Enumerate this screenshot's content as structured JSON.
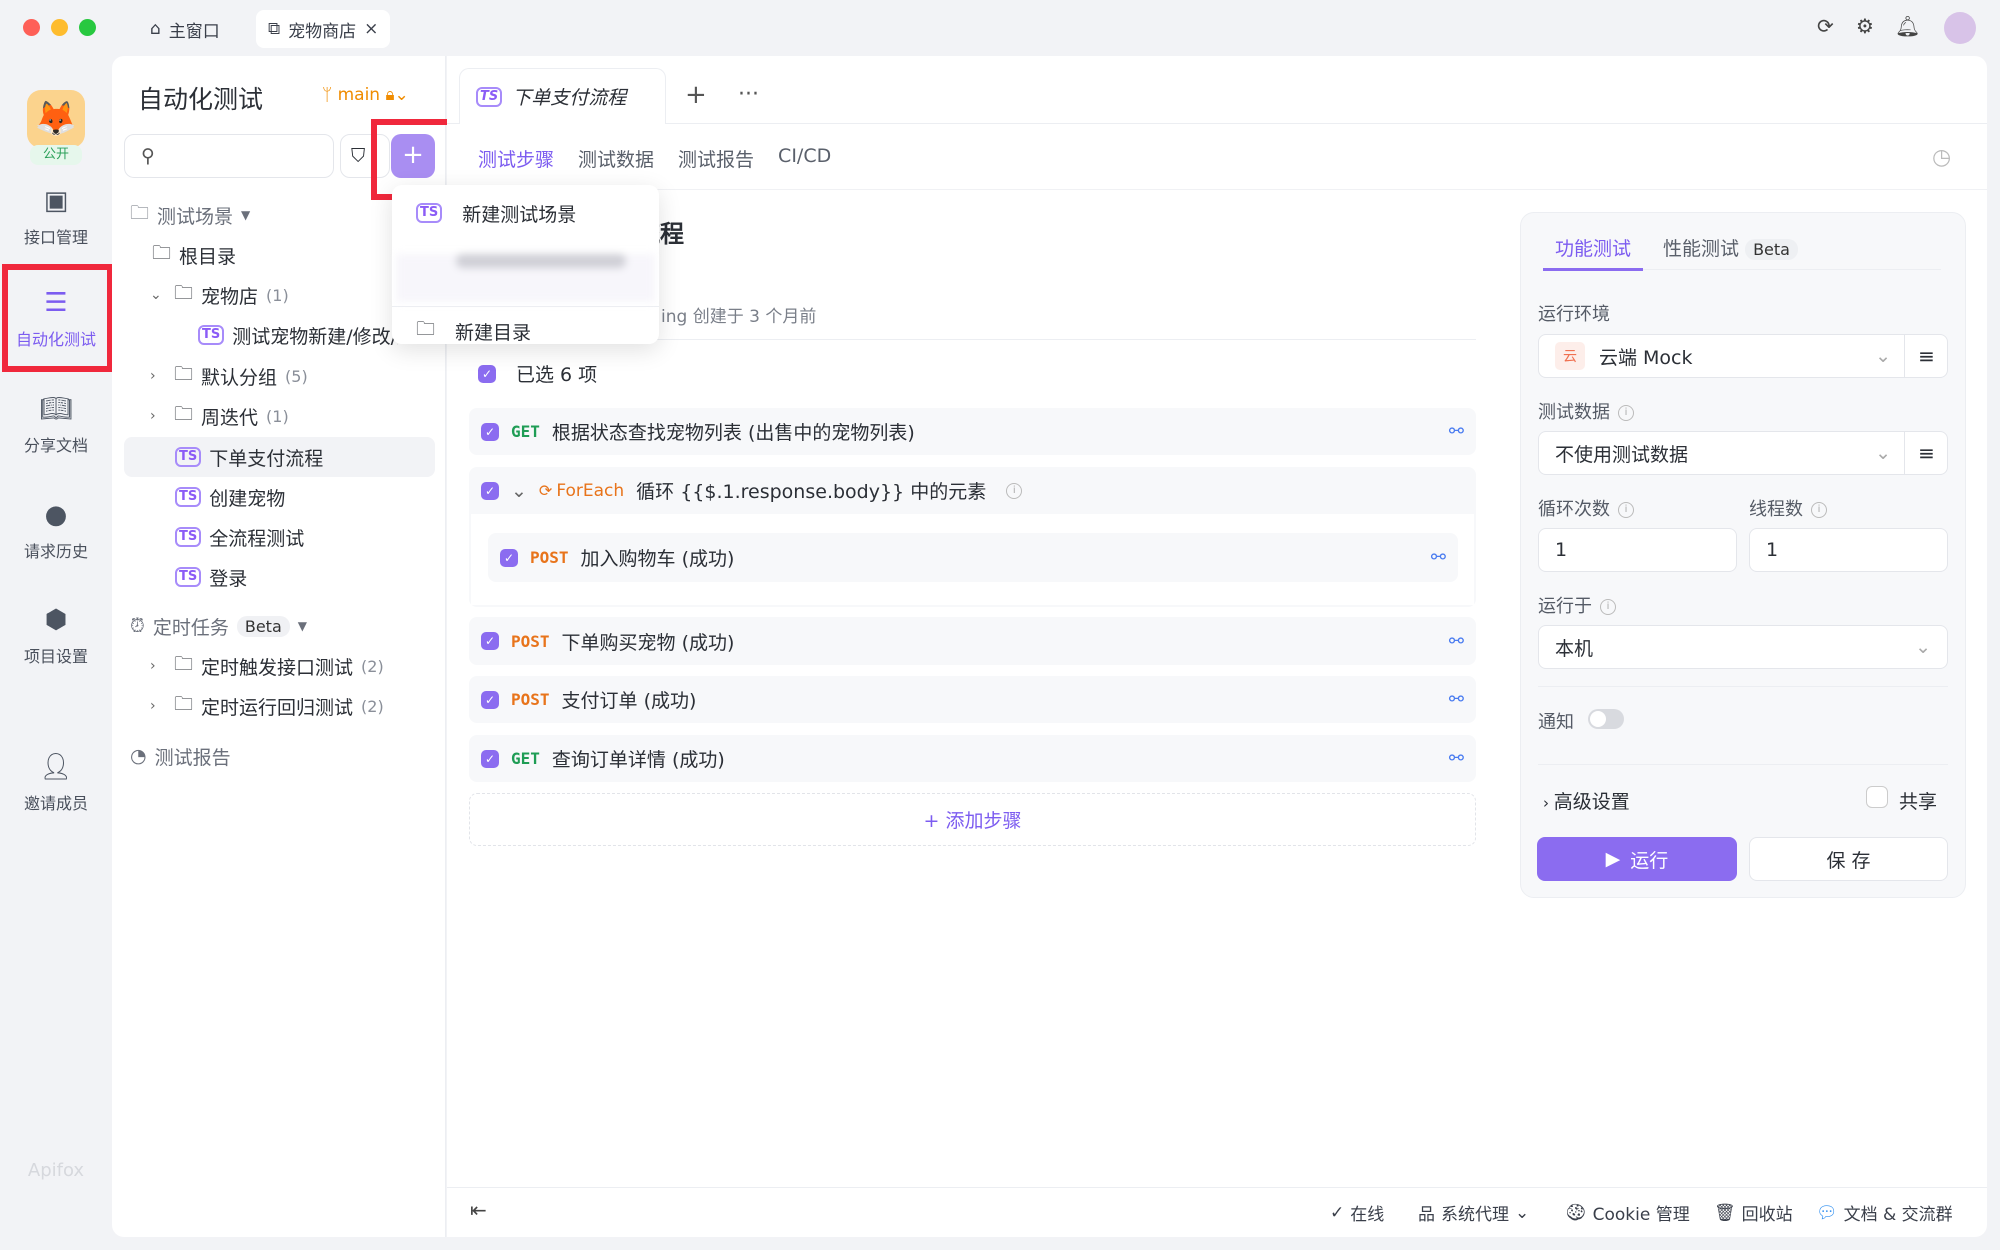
{
  "window": {
    "tabs": [
      {
        "label": "主窗口",
        "icon": "home-icon"
      },
      {
        "label": "宠物商店",
        "icon": "external-link-icon",
        "close": "×"
      }
    ]
  },
  "rail": {
    "project_badge": "公开",
    "items": [
      {
        "label": "接口管理",
        "icon": "api-icon"
      },
      {
        "label": "自动化测试",
        "icon": "automation-icon",
        "active": true
      },
      {
        "label": "分享文档",
        "icon": "book-icon"
      },
      {
        "label": "请求历史",
        "icon": "clock-icon"
      },
      {
        "label": "项目设置",
        "icon": "settings-icon"
      },
      {
        "label": "邀请成员",
        "icon": "add-user-icon"
      }
    ],
    "logo": "Apifox"
  },
  "sidebar": {
    "title": "自动化测试",
    "branch": "main",
    "search_placeholder": "",
    "add_label": "+",
    "sections": {
      "scenarios": "测试场景",
      "root": "根目录",
      "petstore": "宠物店",
      "petstore_count": "(1)",
      "petstore_child": "测试宠物新建/修改/删除",
      "default_group": "默认分组",
      "default_count": "(5)",
      "weekly": "周迭代",
      "weekly_count": "(1)",
      "items": [
        "下单支付流程",
        "创建宠物",
        "全流程测试",
        "登录"
      ],
      "scheduled": "定时任务",
      "beta": "Beta",
      "sched_folders": [
        {
          "label": "定时触发接口测试",
          "count": "(2)"
        },
        {
          "label": "定时运行回归测试",
          "count": "(2)"
        }
      ],
      "reports": "测试报告"
    }
  },
  "menu": {
    "items": [
      "新建测试场景",
      "新建目录"
    ]
  },
  "main": {
    "tab": "下单支付流程",
    "subtabs": [
      "测试步骤",
      "测试数据",
      "测试报告",
      "CI/CD"
    ],
    "title": "下单支付流程",
    "meta": "ing 创建于 3 个月前",
    "selected": "已选 6 项",
    "steps": [
      {
        "method": "GET",
        "name": "根据状态查找宠物列表 (出售中的宠物列表)"
      },
      {
        "method": "ForEach",
        "name": "循环 {{$.1.response.body}} 中的元素"
      },
      {
        "method": "POST",
        "name": "加入购物车 (成功)"
      },
      {
        "method": "POST",
        "name": "下单购买宠物 (成功)"
      },
      {
        "method": "POST",
        "name": "支付订单 (成功)"
      },
      {
        "method": "GET",
        "name": "查询订单详情 (成功)"
      }
    ],
    "add_step": "+ 添加步骤"
  },
  "run": {
    "tabs": [
      "功能测试",
      "性能测试"
    ],
    "beta": "Beta",
    "env_label": "运行环境",
    "env_badge": "云",
    "env": "云端 Mock",
    "data_label": "测试数据",
    "data": "不使用测试数据",
    "loops_label": "循环次数",
    "loops": "1",
    "threads_label": "线程数",
    "threads": "1",
    "runon_label": "运行于",
    "runon": "本机",
    "notify_label": "通知",
    "notify_on": false,
    "advanced": "高级设置",
    "share": "共享",
    "run_btn": "运行",
    "save_btn": "保 存"
  },
  "status": {
    "online": "在线",
    "proxy": "系统代理",
    "cookie": "Cookie 管理",
    "trash": "回收站",
    "docs": "文档 & 交流群"
  },
  "colors": {
    "accent": "#8b6cf0",
    "highlight": "#f0283c"
  }
}
